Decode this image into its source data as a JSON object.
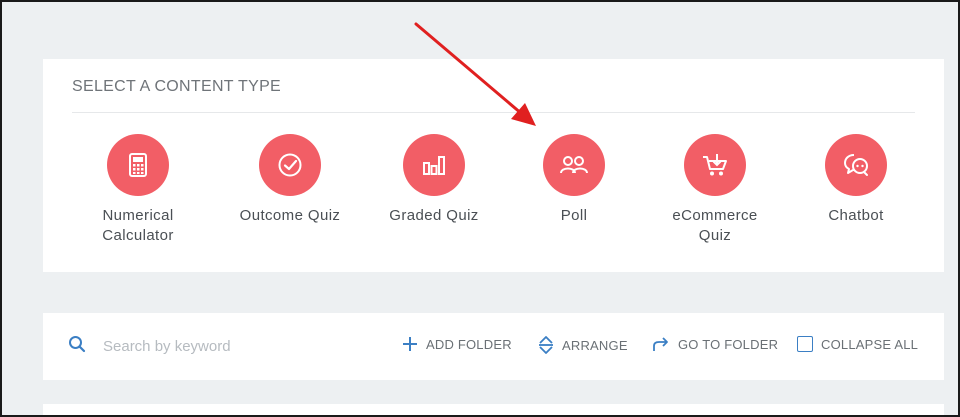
{
  "panel": {
    "title": "SELECT A CONTENT TYPE",
    "types": [
      {
        "name": "numerical-calculator",
        "label": "Numerical Calculator",
        "line1": "Numerical",
        "line2": "Calculator",
        "icon": "calculator-icon"
      },
      {
        "name": "outcome-quiz",
        "label": "Outcome Quiz",
        "line1": "Outcome Quiz",
        "line2": "",
        "icon": "check-circle-icon"
      },
      {
        "name": "graded-quiz",
        "label": "Graded Quiz",
        "line1": "Graded Quiz",
        "line2": "",
        "icon": "bar-chart-icon"
      },
      {
        "name": "poll",
        "label": "Poll",
        "line1": "Poll",
        "line2": "",
        "icon": "people-icon"
      },
      {
        "name": "ecommerce-quiz",
        "label": "eCommerce Quiz",
        "line1": "eCommerce",
        "line2": "Quiz",
        "icon": "cart-icon"
      },
      {
        "name": "chatbot",
        "label": "Chatbot",
        "line1": "Chatbot",
        "line2": "",
        "icon": "chat-bubble-icon"
      }
    ]
  },
  "toolbar": {
    "search_placeholder": "Search by keyword",
    "search_value": "",
    "add_folder": "ADD FOLDER",
    "arrange": "ARRANGE",
    "go_to_folder": "GO TO FOLDER",
    "collapse_all": "COLLAPSE ALL",
    "collapse_all_checked": false
  },
  "colors": {
    "accent": "#f25e66",
    "arrow": "#e02020",
    "link_blue": "#3b7fc4",
    "background": "#edf0f2"
  }
}
